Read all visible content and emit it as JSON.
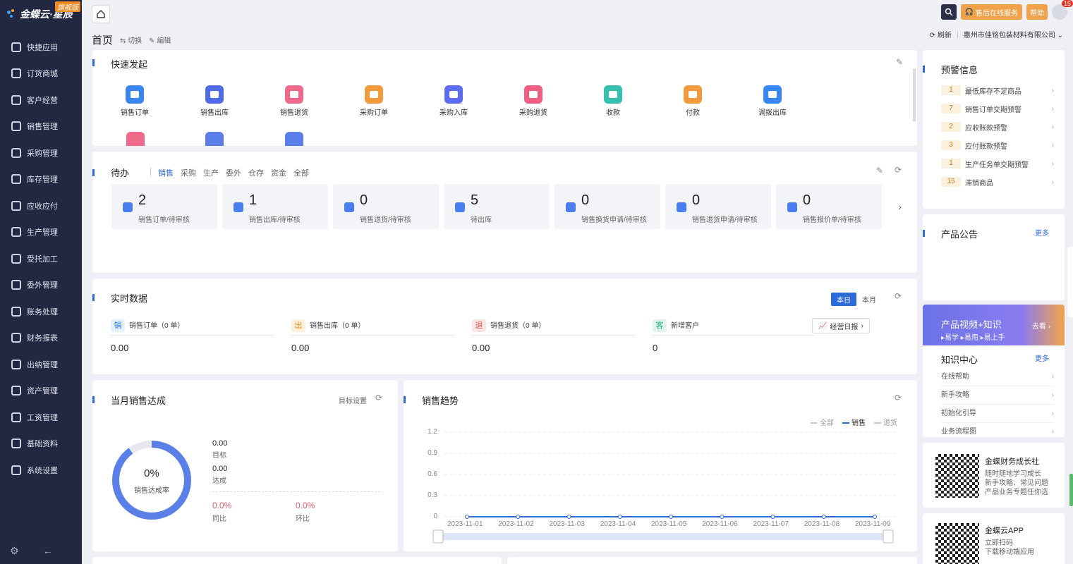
{
  "sidebar": {
    "logo": "金蝶云·星辰",
    "edition": "旗舰版",
    "items": [
      {
        "label": "快捷应用",
        "icon": "grid-icon"
      },
      {
        "label": "订货商城",
        "icon": "shop-bag-icon"
      },
      {
        "label": "客户经营",
        "icon": "user-icon"
      },
      {
        "label": "销售管理",
        "icon": "sales-chart-icon"
      },
      {
        "label": "采购管理",
        "icon": "cart-icon"
      },
      {
        "label": "库存管理",
        "icon": "box-icon"
      },
      {
        "label": "应收应付",
        "icon": "money-icon"
      },
      {
        "label": "生产管理",
        "icon": "factory-icon"
      },
      {
        "label": "受托加工",
        "icon": "tools-icon"
      },
      {
        "label": "委外管理",
        "icon": "outsource-icon"
      },
      {
        "label": "账务处理",
        "icon": "ledger-icon"
      },
      {
        "label": "财务报表",
        "icon": "report-icon"
      },
      {
        "label": "出纳管理",
        "icon": "cashier-icon"
      },
      {
        "label": "资产管理",
        "icon": "asset-icon"
      },
      {
        "label": "工资管理",
        "icon": "salary-icon"
      },
      {
        "label": "基础资料",
        "icon": "layers-icon"
      },
      {
        "label": "系统设置",
        "icon": "settings-icon"
      }
    ]
  },
  "topbar": {
    "service": "售后在线服务",
    "help": "帮助",
    "notify_count": "15",
    "refresh": "刷新",
    "company": "惠州市佳铭包装材料有限公司"
  },
  "page": {
    "title": "首页",
    "switch": "切换",
    "edit": "编辑"
  },
  "quick": {
    "title": "快速发起",
    "items": [
      {
        "label": "销售订单",
        "color": "#3a86f0"
      },
      {
        "label": "销售出库",
        "color": "#4f6be8"
      },
      {
        "label": "销售退货",
        "color": "#ef6a8a"
      },
      {
        "label": "采购订单",
        "color": "#f39a3d"
      },
      {
        "label": "采购入库",
        "color": "#5b6cf0"
      },
      {
        "label": "采购退货",
        "color": "#ef5f84"
      },
      {
        "label": "收款",
        "color": "#35c0b0"
      },
      {
        "label": "付款",
        "color": "#f39a3d"
      },
      {
        "label": "调拨出库",
        "color": "#3a86f0"
      }
    ]
  },
  "todo": {
    "title": "待办",
    "tabs": [
      "销售",
      "采购",
      "生产",
      "委外",
      "仓存",
      "资金",
      "全部"
    ],
    "items": [
      {
        "num": "2",
        "label": "销售订单/待审核",
        "color": "#4b7ff0"
      },
      {
        "num": "1",
        "label": "销售出库/待审核",
        "color": "#4b7ff0"
      },
      {
        "num": "0",
        "label": "销售退货/待审核",
        "color": "#4b7ff0"
      },
      {
        "num": "5",
        "label": "待出库",
        "color": "#4b7ff0"
      },
      {
        "num": "0",
        "label": "销售换货申请/待审核",
        "color": "#4b7ff0"
      },
      {
        "num": "0",
        "label": "销售退货申请/待审核",
        "color": "#4b7ff0"
      },
      {
        "num": "0",
        "label": "销售报价单/待审核",
        "color": "#4b7ff0"
      }
    ]
  },
  "realtime": {
    "title": "实时数据",
    "tab_today": "本日",
    "tab_month": "本月",
    "daily_report": "经营日报",
    "items": [
      {
        "badge": "销",
        "name": "销售订单（0 单）",
        "value": "0.00",
        "bg": "#e3f0fd",
        "fg": "#2c7be5"
      },
      {
        "badge": "出",
        "name": "销售出库（0 单）",
        "value": "0.00",
        "bg": "#fdf0dc",
        "fg": "#e08a20"
      },
      {
        "badge": "退",
        "name": "销售退货（0 单）",
        "value": "0.00",
        "bg": "#fde6e6",
        "fg": "#e05050"
      },
      {
        "badge": "客",
        "name": "新增客户",
        "value": "0",
        "bg": "#dff5ee",
        "fg": "#2ba97a"
      }
    ]
  },
  "achieve": {
    "title": "当月销售达成",
    "target_setting": "目标设置",
    "percent": "0%",
    "rate_label": "销售达成率",
    "progress": 0.9,
    "target_value": "0.00",
    "target_label": "目标",
    "reached_value": "0.00",
    "reached_label": "达成",
    "yoy_value": "0.0%",
    "yoy_label": "同比",
    "mom_value": "0.0%",
    "mom_label": "环比"
  },
  "trend": {
    "title": "销售趋势",
    "legend": [
      "全部",
      "销售",
      "退货"
    ]
  },
  "chart_data": {
    "type": "line",
    "title": "销售趋势",
    "x": [
      "2023-11-01",
      "2023-11-02",
      "2023-11-03",
      "2023-11-04",
      "2023-11-05",
      "2023-11-06",
      "2023-11-07",
      "2023-11-08",
      "2023-11-09"
    ],
    "series": [
      {
        "name": "销售",
        "values": [
          0,
          0,
          0,
          0,
          0,
          0,
          0,
          0,
          0
        ]
      }
    ],
    "yticks": [
      "1.2",
      "0.9",
      "0.6",
      "0.3",
      "0"
    ],
    "ylim": [
      0,
      1.2
    ],
    "legend": [
      "全部",
      "销售",
      "退货"
    ]
  },
  "warning": {
    "title": "预警信息",
    "items": [
      {
        "count": "1",
        "label": "最低库存不足商品"
      },
      {
        "count": "7",
        "label": "销售订单交期预警"
      },
      {
        "count": "2",
        "label": "应收账款预警"
      },
      {
        "count": "3",
        "label": "应付账款预警"
      },
      {
        "count": "1",
        "label": "生产任务单交期预警"
      },
      {
        "count": "15",
        "label": "滞销商品"
      }
    ]
  },
  "notice": {
    "title": "产品公告",
    "more": "更多"
  },
  "promo": {
    "title": "产品视频+知识",
    "subtitle": "▸易学 ▸易用 ▸易上手",
    "go": "去看 ›"
  },
  "knowledge": {
    "title": "知识中心",
    "more": "更多",
    "items": [
      "在线帮助",
      "新手攻略",
      "初始化引导",
      "业务流程图"
    ]
  },
  "community": {
    "title": "金蝶财务成长社",
    "lines": [
      "随时随地学习成长",
      "新手攻略、常见问题",
      "产品业务专题任你选"
    ]
  },
  "app": {
    "title": "金蝶云APP",
    "lines": [
      "立即扫码",
      "下载移动端应用"
    ]
  }
}
